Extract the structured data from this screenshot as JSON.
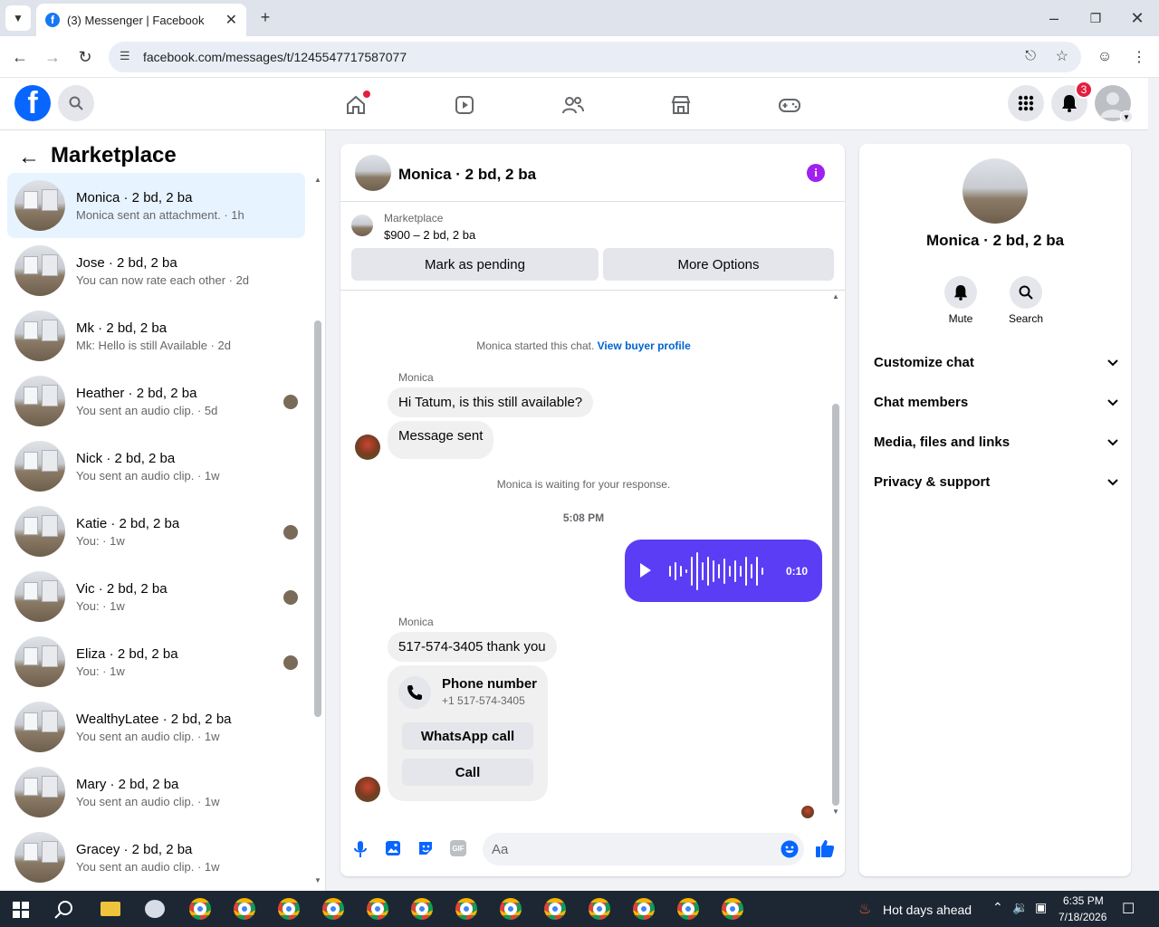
{
  "browser": {
    "tab_title": "(3) Messenger | Facebook",
    "url": "facebook.com/messages/t/1245547717587077"
  },
  "topnav": {
    "notification_count": "3"
  },
  "left": {
    "title": "Marketplace",
    "conversations": [
      {
        "name": "Monica · 2 bd, 2 ba",
        "snippet": "Monica sent an attachment. · 1h",
        "active": true
      },
      {
        "name": "Jose · 2 bd, 2 ba",
        "snippet": "You can now rate each other · 2d"
      },
      {
        "name": "Mk · 2 bd, 2 ba",
        "snippet": "Mk: Hello is still Available · 2d"
      },
      {
        "name": "Heather · 2 bd, 2 ba",
        "snippet": "You sent an audio clip. · 5d"
      },
      {
        "name": "Nick · 2 bd, 2 ba",
        "snippet": "You sent an audio clip. · 1w"
      },
      {
        "name": "Katie · 2 bd, 2 ba",
        "snippet": "You: · 1w"
      },
      {
        "name": "Vic · 2 bd, 2 ba",
        "snippet": "You: · 1w"
      },
      {
        "name": "Eliza · 2 bd, 2 ba",
        "snippet": "You: · 1w"
      },
      {
        "name": "WealthyLatee · 2 bd, 2 ba",
        "snippet": "You sent an audio clip. · 1w"
      },
      {
        "name": "Mary · 2 bd, 2 ba",
        "snippet": "You sent an audio clip. · 1w"
      },
      {
        "name": "Gracey · 2 bd, 2 ba",
        "snippet": "You sent an audio clip. · 1w"
      }
    ]
  },
  "chat": {
    "title": "Monica · 2 bd, 2 ba",
    "listing_label": "Marketplace",
    "listing_price": "$900 – 2 bd, 2 ba",
    "mark_pending": "Mark as pending",
    "more_options": "More Options",
    "started_text": "Monica started this chat.",
    "view_buyer": "View buyer profile",
    "sender1": "Monica",
    "msg1": "Hi Tatum, is this still available?",
    "msg2": "Message sent",
    "waiting": "Monica is waiting for your response.",
    "time": "5:08 PM",
    "audio_duration": "0:10",
    "sender2": "Monica",
    "msg3": "517-574-3405 thank you",
    "phone_title": "Phone number",
    "phone_number": "+1 517-574-3405",
    "whatsapp": "WhatsApp call",
    "call": "Call",
    "input_placeholder": "Aa"
  },
  "right": {
    "name": "Monica · 2 bd, 2 ba",
    "mute": "Mute",
    "search": "Search",
    "sections": [
      "Customize chat",
      "Chat members",
      "Media, files and links",
      "Privacy & support"
    ]
  },
  "taskbar": {
    "weather": "Hot days ahead",
    "time": "6:35 PM",
    "date": "7/18/2026"
  },
  "colors": {
    "accent": "#0866ff",
    "audio_bubble": "#5b3df5",
    "info": "#a020f0"
  }
}
